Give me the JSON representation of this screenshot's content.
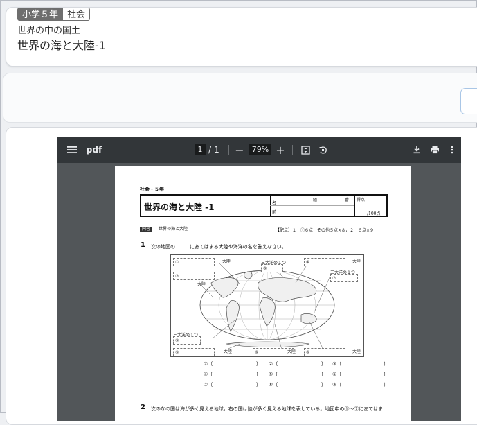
{
  "header": {
    "grade": "小学５年",
    "subject": "社会",
    "unit": "世界の中の国土",
    "title": "世界の海と大陸-1"
  },
  "viewer": {
    "app_label": "pdf",
    "page_current": "1",
    "page_separator": "/",
    "page_total": "1",
    "zoom_out": "−",
    "zoom_level": "79%",
    "zoom_in": "+",
    "icons": [
      "menu-icon",
      "fit-page-icon",
      "rotate-icon",
      "download-icon",
      "print-icon",
      "more-vert-icon"
    ]
  },
  "worksheet": {
    "subject_grade": "社会・５年",
    "title": "世界の海と大陸 -1",
    "class_label": "組",
    "number_label": "番",
    "name_label_1": "名",
    "name_label_2": "前",
    "score_label": "得点",
    "score_max": "/100点",
    "content_tag": "内容",
    "content_text": "世界の海と大陸",
    "points": "【配点】１　①６点　その他５点×８，２　６点×９",
    "q1_number": "1",
    "q1_text": "次の地図の　　　にあてはまる大陸や海洋の名を答えなさい。",
    "map_labels": {
      "l1": "①",
      "l1_suffix": "大陸",
      "l2": "②",
      "l2_suffix": "大陸",
      "l3_note": "三大洋の１つ",
      "l3": "③",
      "l4": "④",
      "l4_suffix": "大陸",
      "l5": "⑤",
      "l5_suffix": "大陸",
      "l6": "⑥",
      "l6_suffix": "大陸",
      "l7_note": "三大洋の１つ",
      "l7": "⑦",
      "l8": "⑧",
      "l8_suffix": "大陸",
      "l9_note": "三大洋の１つ",
      "l9": "⑨"
    },
    "answers": [
      [
        "①〔",
        "〕",
        "②〔",
        "〕",
        "③〔",
        "〕"
      ],
      [
        "④〔",
        "〕",
        "⑤〔",
        "〕",
        "⑥〔",
        "〕"
      ],
      [
        "⑦〔",
        "〕",
        "⑧〔",
        "〕",
        "⑨〔",
        "〕"
      ]
    ],
    "q2_number": "2",
    "q2_text": "次のなの国は海が多く見える地球，右の国は陸が多く見える地球を表している。地図中の①～⑦にあてはま"
  }
}
